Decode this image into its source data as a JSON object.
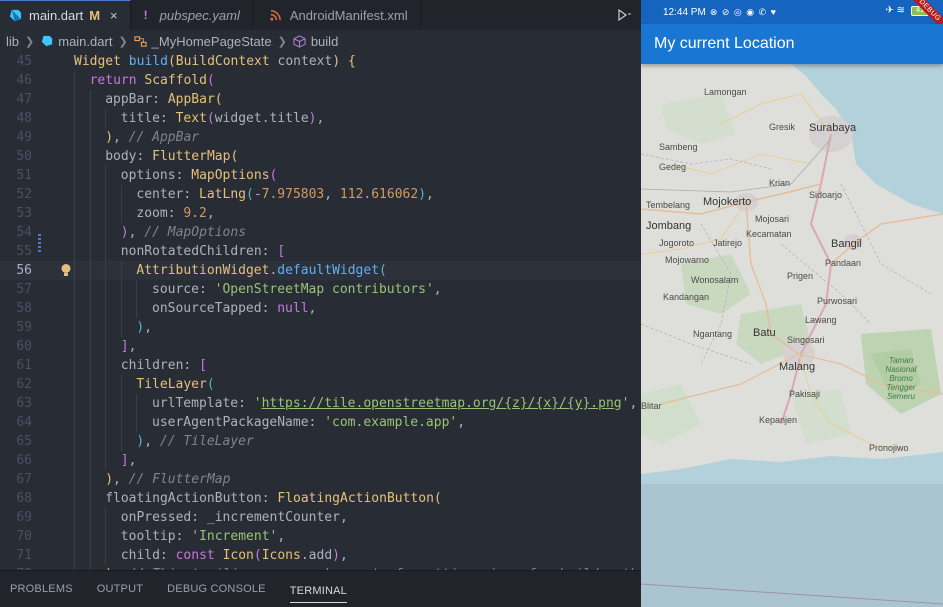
{
  "editor": {
    "tabs": [
      {
        "label": "main.dart",
        "modified": "M",
        "close": "×",
        "icon": "dart-icon",
        "active": true
      },
      {
        "label": "pubspec.yaml",
        "icon": "exclamation-icon",
        "active": false
      },
      {
        "label": "AndroidManifest.xml",
        "icon": "rss-icon",
        "active": false
      }
    ],
    "breadcrumb": [
      "lib",
      "main.dart",
      "_MyHomePageState",
      "build"
    ],
    "current_line": 56,
    "lines": [
      {
        "n": "45",
        "indent": 0,
        "html": "<span class='t-fn'>Widget</span> <span class='t-meth'>build</span><span class='t-br1'>(</span><span class='t-fn'>BuildContext</span> context<span class='t-br1'>)</span> <span class='t-br1'>{</span>"
      },
      {
        "n": "46",
        "indent": 1,
        "html": "<span class='t-kw'>return</span> <span class='t-fn'>Scaffold</span><span class='t-br2'>(</span>"
      },
      {
        "n": "47",
        "indent": 2,
        "html": "appBar: <span class='t-fn'>AppBar</span><span class='t-br1'>(</span>"
      },
      {
        "n": "48",
        "indent": 3,
        "html": "title: <span class='t-fn'>Text</span><span class='t-br2'>(</span>widget.title<span class='t-br2'>)</span>,"
      },
      {
        "n": "49",
        "indent": 2,
        "html": "<span class='t-br1'>)</span>, <span class='t-com'>// AppBar</span>"
      },
      {
        "n": "50",
        "indent": 2,
        "html": "body: <span class='t-fn'>FlutterMap</span><span class='t-br1'>(</span>"
      },
      {
        "n": "51",
        "indent": 3,
        "html": "options: <span class='t-fn'>MapOptions</span><span class='t-br2'>(</span>"
      },
      {
        "n": "52",
        "indent": 4,
        "html": "center: <span class='t-fn'>LatLng</span><span class='t-br3'>(</span>-<span class='t-num'>7.975803</span>, <span class='t-num'>112.616062</span><span class='t-br3'>)</span>,"
      },
      {
        "n": "53",
        "indent": 4,
        "html": "zoom: <span class='t-num'>9.2</span>,"
      },
      {
        "n": "54",
        "indent": 3,
        "html": "<span class='t-br2'>)</span>, <span class='t-com'>// MapOptions</span>"
      },
      {
        "n": "55",
        "indent": 3,
        "html": "nonRotatedChildren: <span class='t-br2'>[</span>"
      },
      {
        "n": "56",
        "indent": 4,
        "html": "<span class='t-fn'>AttributionWidget</span>.<span class='t-meth'>defaultWidget</span><span class='t-br3'>(</span>"
      },
      {
        "n": "57",
        "indent": 5,
        "html": "source: <span class='t-str'>'OpenStreetMap contributors'</span>,"
      },
      {
        "n": "58",
        "indent": 5,
        "html": "onSourceTapped: <span class='t-kw'>null</span>,"
      },
      {
        "n": "59",
        "indent": 4,
        "html": "<span class='t-br3'>)</span>,"
      },
      {
        "n": "60",
        "indent": 3,
        "html": "<span class='t-br2'>]</span>,"
      },
      {
        "n": "61",
        "indent": 3,
        "html": "children: <span class='t-br2'>[</span>"
      },
      {
        "n": "62",
        "indent": 4,
        "html": "<span class='t-fn'>TileLayer</span><span class='t-br3'>(</span>"
      },
      {
        "n": "63",
        "indent": 5,
        "html": "urlTemplate: <span class='t-str'>'</span><span class='t-link'>https://tile.openstreetmap.org/{z}/{x}/{y}.png</span><span class='t-str'>'</span>,"
      },
      {
        "n": "64",
        "indent": 5,
        "html": "userAgentPackageName: <span class='t-str'>'com.example.app'</span>,"
      },
      {
        "n": "65",
        "indent": 4,
        "html": "<span class='t-br3'>)</span>, <span class='t-com'>// TileLayer</span>"
      },
      {
        "n": "66",
        "indent": 3,
        "html": "<span class='t-br2'>]</span>,"
      },
      {
        "n": "67",
        "indent": 2,
        "html": "<span class='t-br1'>)</span>, <span class='t-com'>// FlutterMap</span>"
      },
      {
        "n": "68",
        "indent": 2,
        "html": "floatingActionButton: <span class='t-fn'>FloatingActionButton</span><span class='t-br1'>(</span>"
      },
      {
        "n": "69",
        "indent": 3,
        "html": "onPressed: _incrementCounter,"
      },
      {
        "n": "70",
        "indent": 3,
        "html": "tooltip: <span class='t-str'>'Increment'</span>,"
      },
      {
        "n": "71",
        "indent": 3,
        "html": "child: <span class='t-kw'>const</span> <span class='t-fn'>Icon</span><span class='t-br2'>(</span><span class='t-fn'>Icons</span>.add<span class='t-br2'>)</span>,"
      },
      {
        "n": "72",
        "indent": 2,
        "html": "<span class='t-br1'>)</span>, <span class='t-com'>// This trailing comma makes auto-formatting nicer for build metho</span>"
      }
    ],
    "panel_tabs": [
      "PROBLEMS",
      "OUTPUT",
      "DEBUG CONSOLE",
      "TERMINAL"
    ],
    "active_panel": "TERMINAL"
  },
  "phone": {
    "status_time": "12:44 PM",
    "status_icons": "⊗ ⊘ ◎ ◉ ✆ ♥",
    "status_right": "✈ ≋",
    "battery": "41",
    "debug_banner": "DEBUG",
    "app_title": "My current Location",
    "map_labels": [
      {
        "text": "Surabaya",
        "big": true
      },
      {
        "text": "Sambeng"
      },
      {
        "text": "Lamongan"
      },
      {
        "text": "Gresik"
      },
      {
        "text": "Gedeg"
      },
      {
        "text": "Krian"
      },
      {
        "text": "Sidoarjo"
      },
      {
        "text": "Tembelang"
      },
      {
        "text": "Mojokerto",
        "big": true
      },
      {
        "text": "Mojosari"
      },
      {
        "text": "Jombang",
        "big": true
      },
      {
        "text": "Kecamatan"
      },
      {
        "text": "Jogoroto"
      },
      {
        "text": "Jatirejo"
      },
      {
        "text": "Bangil",
        "big": true
      },
      {
        "text": "Mojowarno"
      },
      {
        "text": "Pandaan"
      },
      {
        "text": "Wonosalam"
      },
      {
        "text": "Prigen"
      },
      {
        "text": "Kandangan"
      },
      {
        "text": "Purwosari"
      },
      {
        "text": "Lawang"
      },
      {
        "text": "Batu",
        "big": true
      },
      {
        "text": "Ngantang"
      },
      {
        "text": "Singosari"
      },
      {
        "text": "Malang",
        "big": true
      },
      {
        "text": "Pakisaji"
      },
      {
        "text": "Kepanjen"
      },
      {
        "text": "Blitar"
      },
      {
        "text": "Pronojiwo"
      }
    ],
    "park_label": "Taman Nasional Bromo Tengger Semeru"
  }
}
